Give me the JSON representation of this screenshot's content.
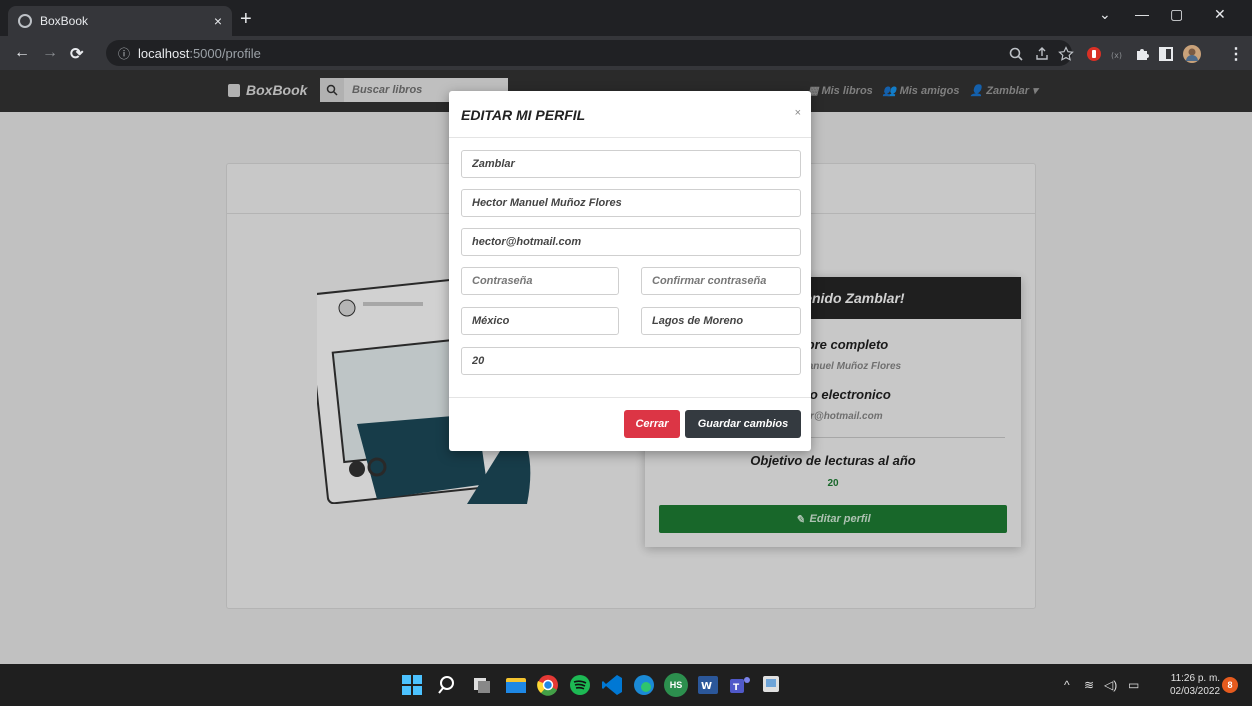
{
  "browser": {
    "tab_title": "BoxBook",
    "tab_close": "×",
    "new_tab": "+",
    "url_host": "localhost",
    "url_path": ":5000/profile",
    "win_minimize": "—",
    "win_restore": "▢",
    "win_close": "✕",
    "win_tabs_dropdown": "⌄"
  },
  "navbar": {
    "brand": "BoxBook",
    "search_placeholder": "Buscar libros",
    "links": [
      "Mis libros",
      "Mis amigos",
      "Zamblar"
    ]
  },
  "profile": {
    "welcome": "¡Bienvenido Zamblar!",
    "fullname_label": "Nombre completo",
    "fullname_value": "Hector Manuel Muñoz Flores",
    "email_label": "Correo electronico",
    "email_value": "hector@hotmail.com",
    "goal_label": "Objetivo de lecturas al año",
    "goal_value": "20",
    "edit_button": "Editar perfil"
  },
  "modal": {
    "title": "EDITAR MI PERFIL",
    "close": "×",
    "username": "Zamblar",
    "fullname": "Hector Manuel Muñoz Flores",
    "email": "hector@hotmail.com",
    "password_placeholder": "Contraseña",
    "confirm_placeholder": "Confirmar contraseña",
    "country": "México",
    "city": "Lagos de Moreno",
    "goal": "20",
    "cancel_button": "Cerrar",
    "save_button": "Guardar cambios"
  },
  "taskbar": {
    "time": "11:26 p. m.",
    "date": "02/03/2022",
    "notifications": "8",
    "app_labels": [
      "HS"
    ]
  },
  "colors": {
    "navbar": "#343434",
    "danger": "#dc3545",
    "dark": "#343a40",
    "success": "#1e7e34"
  }
}
